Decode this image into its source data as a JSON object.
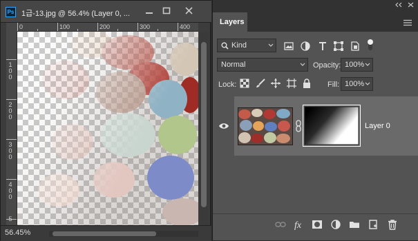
{
  "document": {
    "title": "1급-13.jpg @ 56.4% (Layer 0, ...",
    "ps_badge": "Ps",
    "zoom": "56.45%",
    "ruler_top": [
      "0",
      "100",
      "200",
      "300",
      "400"
    ],
    "ruler_left": [
      "1 0 0",
      "2 0 0",
      "3 0 0",
      "4 0 0",
      "5"
    ]
  },
  "panel": {
    "tab": "Layers",
    "filter_kind": "Kind",
    "blend_mode": "Normal",
    "opacity_label": "Opacity:",
    "opacity_value": "100%",
    "lock_label": "Lock:",
    "fill_label": "Fill:",
    "fill_value": "100%",
    "layer_name": "Layer 0"
  },
  "colors": {
    "accent": "#31a8ff",
    "panel_bg": "#535353",
    "selected_layer": "#6a6a6a"
  }
}
